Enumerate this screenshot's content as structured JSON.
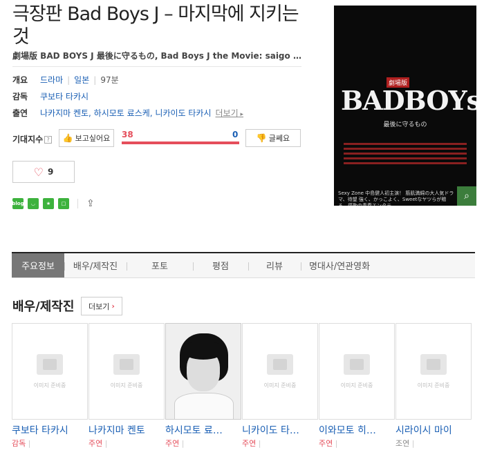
{
  "title": "극장판 Bad Boys J – 마지막에 지키는 것",
  "original_title": "劇場版 BAD BOYS J 最後に守るもの, Bad Boys J the Movie: saigo ni m...",
  "overview": {
    "label": "개요",
    "genre": "드라마",
    "country": "일본",
    "runtime": "97분"
  },
  "director": {
    "label": "감독",
    "name": "쿠보타 타카시"
  },
  "cast_row": {
    "label": "출연",
    "names": "나카지마 켄토, 하시모토 료스케, 니카이도 타카시",
    "more": "더보기"
  },
  "expect": {
    "label": "기대지수",
    "help": "?",
    "want_label": "보고싶어요",
    "want_count": "38",
    "no_count": "0",
    "no_label": "글쎄요",
    "ratio": 1.0
  },
  "like": {
    "count": "9"
  },
  "share": {
    "icons": [
      "blog",
      "band",
      "star",
      "square"
    ]
  },
  "poster": {
    "badge": "劇場版",
    "logo": "BADBOYs",
    "subtitle": "最後に守るもの",
    "tagline": "Sexy Zone 中島健人初主演！ 筋肌満綿の大人気ドラマ、待望 強く、かっこよく、Sweetなヤツらが贈る、感動の青春エンタテ"
  },
  "tabs": [
    "주요정보",
    "배우/제작진",
    "포토",
    "평점",
    "리뷰",
    "명대사/연관영화"
  ],
  "section": {
    "title": "배우/제작진",
    "more": "더보기"
  },
  "placeholder_text": "이미지 준비중",
  "cast": [
    {
      "name": "쿠보타 타카시",
      "role": "감독"
    },
    {
      "name": "나카지마 켄토",
      "role": "주연"
    },
    {
      "name": "하시모토 료…",
      "role": "주연"
    },
    {
      "name": "니카이도 타…",
      "role": "주연"
    },
    {
      "name": "이와모토 히…",
      "role": "주연"
    },
    {
      "name": "시라이시 마이",
      "role": "조연"
    }
  ],
  "colors": {
    "accent_red": "#e54e5b",
    "link_blue": "#1a5fb4",
    "zoom_green": "#3c7d3c"
  }
}
